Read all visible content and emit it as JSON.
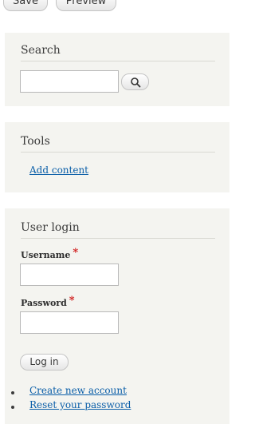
{
  "top_buttons": {
    "save_label": "Save",
    "preview_label": "Preview"
  },
  "search_block": {
    "title": "Search",
    "input_value": "",
    "button_icon": "search-icon"
  },
  "tools_block": {
    "title": "Tools",
    "links": [
      "Add content"
    ]
  },
  "login_block": {
    "title": "User login",
    "username_label": "Username",
    "password_label": "Password",
    "required_marker": "*",
    "username_value": "",
    "password_value": "",
    "login_button": "Log in",
    "links": [
      "Create new account",
      "Reset your password"
    ]
  },
  "colors": {
    "link": "#0a5ea8",
    "required": "#d01a1a",
    "block_bg": "#f4f4f0"
  }
}
